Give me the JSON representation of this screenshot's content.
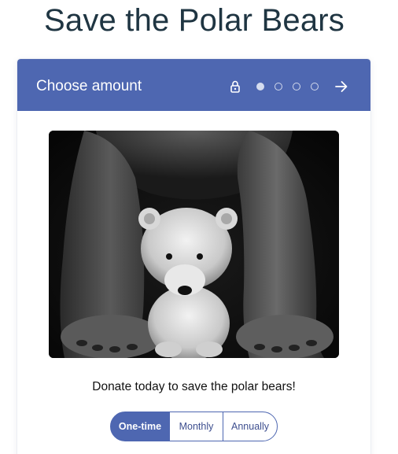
{
  "page": {
    "title": "Save the Polar Bears"
  },
  "wizard": {
    "step_title": "Choose amount",
    "total_steps": 4,
    "current_step": 1,
    "header_color": "#4e67b1",
    "icons": {
      "lock": "lock-icon",
      "next": "arrow-right-icon"
    }
  },
  "hero": {
    "image": "polar-bear-cub-between-adult-legs-photo"
  },
  "content": {
    "donate_text": "Donate today to save the polar bears!"
  },
  "frequency": {
    "options": [
      "One-time",
      "Monthly",
      "Annually"
    ],
    "selected": "One-time"
  }
}
